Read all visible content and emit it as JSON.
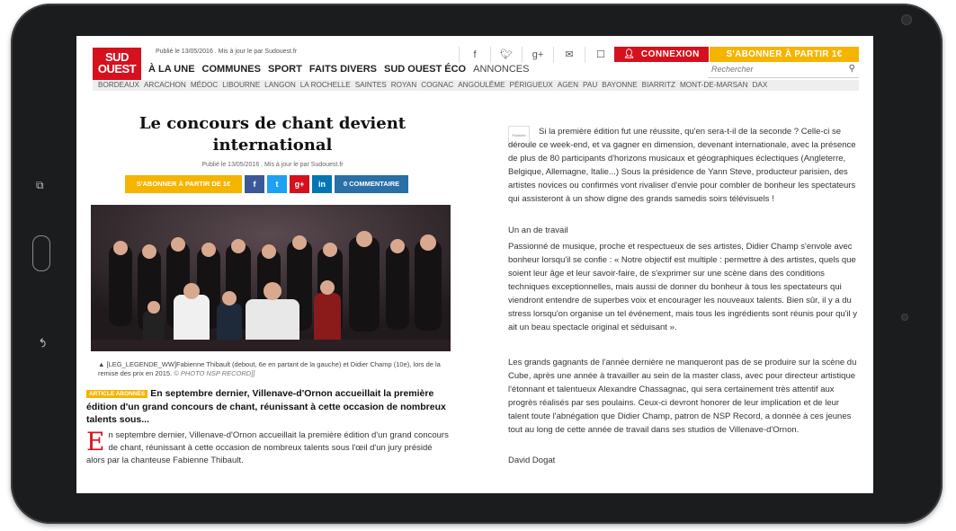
{
  "header": {
    "logo_line1": "SUD",
    "logo_line2": "OUEST",
    "pub_info": "Publié le 13/05/2016 . Mis à jour le par Sudouest.fr",
    "social_icons": [
      "facebook-icon",
      "twitter-icon",
      "googleplus-icon",
      "mail-icon",
      "print-icon"
    ],
    "connexion_label": "CONNEXION",
    "subscribe_label": "S'ABONNER À PARTIR 1€",
    "nav": [
      "À LA UNE",
      "COMMUNES",
      "SPORT",
      "FAITS DIVERS",
      "SUD OUEST ÉCO",
      "ANNONCES"
    ],
    "search_placeholder": "Rechercher",
    "cities": [
      "BORDEAUX",
      "ARCACHON",
      "MÉDOC",
      "LIBOURNE",
      "LANGON",
      "LA ROCHELLE",
      "SAINTES",
      "ROYAN",
      "COGNAC",
      "ANGOULÊME",
      "PÉRIGUEUX",
      "AGEN",
      "PAU",
      "BAYONNE",
      "BIARRITZ",
      "MONT-DE-MARSAN",
      "DAX"
    ]
  },
  "article": {
    "title": "Le concours de chant devient international",
    "pub_info": "Publié le 13/05/2016 . Mis à jour le par Sudouest.fr",
    "subscribe_label": "S'ABONNER À PARTIR DE 1€",
    "share": {
      "facebook": "f",
      "twitter": "t",
      "googleplus": "g+",
      "linkedin": "in"
    },
    "comments_label": "0 COMMENTAIRE",
    "caption": "[LEG_LEGENDE_WW]Fabienne Thibault (debout, 6e en partant de la gauche) et Didier Champ (10e), lors de la remise des prix en 2015.",
    "caption_credit": "© PHOTO NSP RECORD]]",
    "badge": "ARTICLE ABONNÉS",
    "lead": "En septembre dernier, Villenave-d'Ornon accueillait la première édition d'un grand concours de chant, réunissant à cette occasion de nombreux talents sous...",
    "dropcap": "E",
    "body_first": "n septembre dernier, Villenave-d'Ornon accueillait la première édition d'un grand concours de chant, réunissant à cette occasion de nombreux talents sous l'œil d'un jury présidé alors par la chanteuse Fabienne Thibault."
  },
  "right": {
    "ad_label": "Publicité",
    "p1": "Si la première édition fut une réussite, qu'en sera-t-il de la seconde ? Celle-ci se déroule ce week-end, et va gagner en dimension, devenant internationale, avec la présence de plus de 80 participants d'horizons musicaux et géographiques éclectiques (Angleterre, Belgique, Allemagne, Italie...) Sous la présidence de Yann Steve, producteur parisien, des artistes novices ou confirmés vont rivaliser d'envie pour combler de bonheur les spectateurs qui assisteront à un show digne des grands samedis soirs télévisuels !",
    "subheading": "Un an de travail",
    "p2": "Passionné de musique, proche et respectueux de ses artistes, Didier Champ s'envole avec bonheur lorsqu'il se confie : « Notre objectif est multiple : permettre à des artistes, quels que soient leur âge et leur savoir-faire, de s'exprimer sur une scène dans des conditions techniques exceptionnelles, mais aussi de donner du bonheur à tous les spectateurs qui viendront entendre de superbes voix et encourager les nouveaux talents. Bien sûr, il y a du stress lorsqu'on organise un tel événement, mais tous les ingrédients sont réunis pour qu'il y ait un beau spectacle original et séduisant ».",
    "p3": "Les grands gagnants de l'année dernière ne manqueront pas de se produire sur la scène du Cube, après une année à travailler au sein de la master class, avec pour directeur artistique l'étonnant et talentueux Alexandre Chassagnac, qui sera certainement très attentif aux progrès réalisés par ses poulains. Ceux-ci devront honorer de leur implication et de leur talent toute l'abnégation que Didier Champ, patron de NSP Record, a donnée à ces jeunes tout au long de cette année de travail dans ses studios de Villenave-d'Ornon.",
    "signature": "David Dogat"
  }
}
